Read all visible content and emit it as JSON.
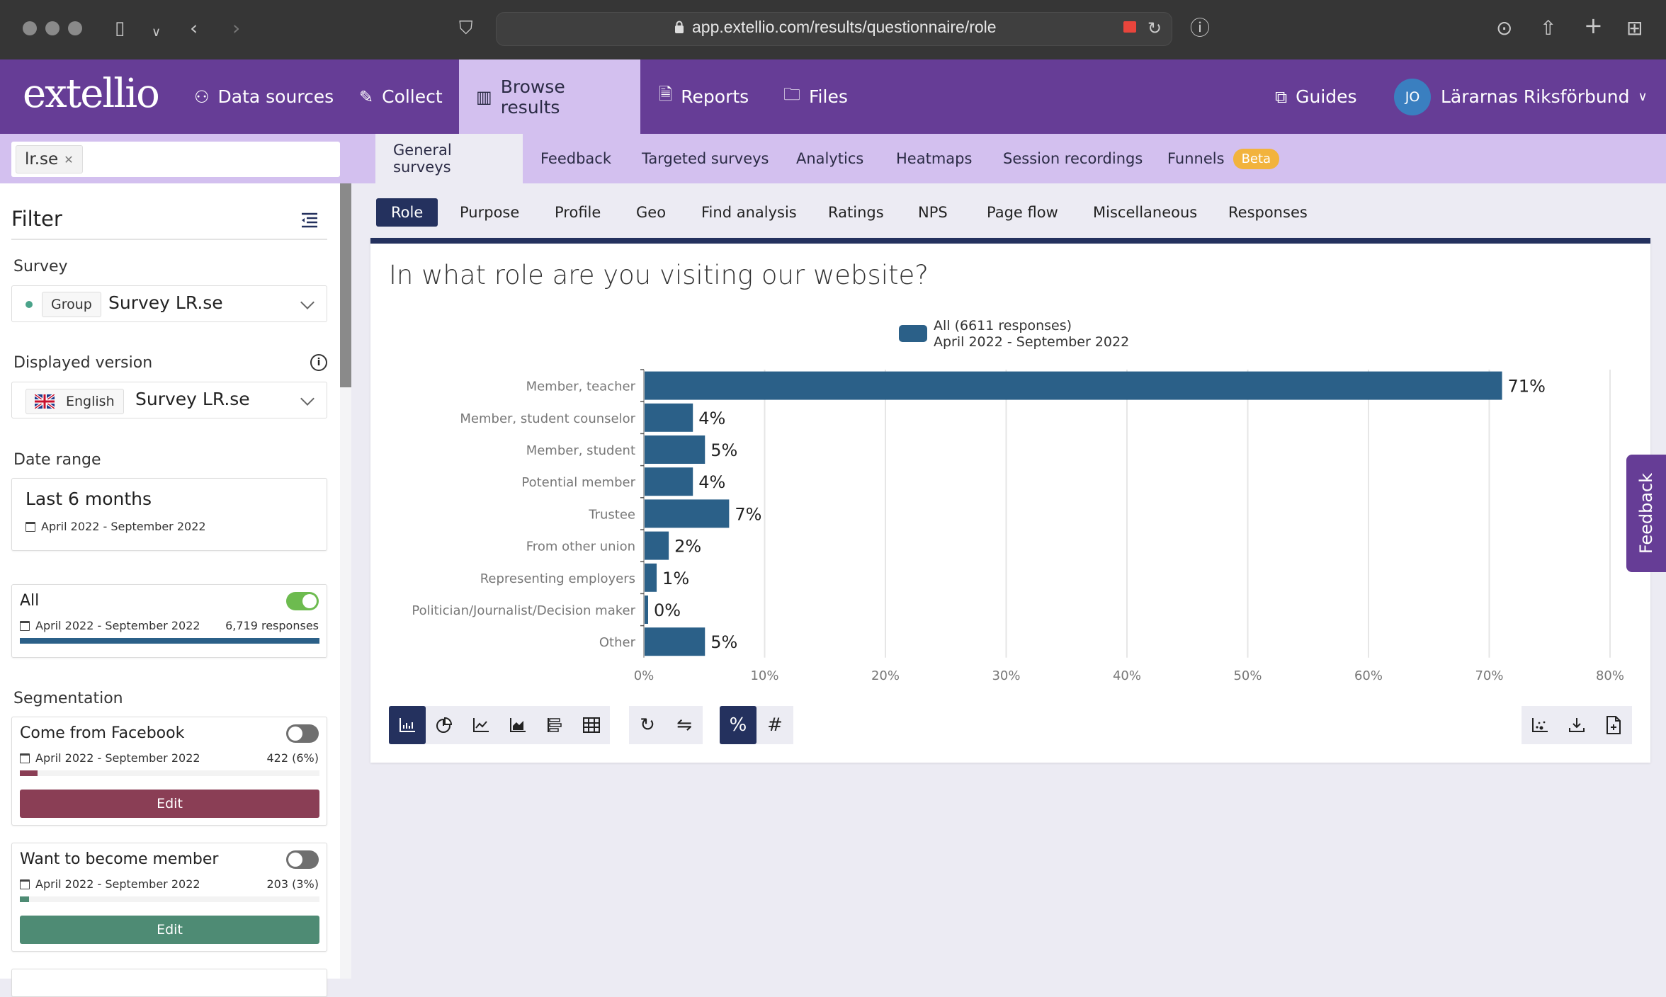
{
  "browser": {
    "url": "app.extellio.com/results/questionnaire/role"
  },
  "nav": {
    "logo": "extellio",
    "items": [
      {
        "label": "Data sources",
        "icon": "sitemap-icon"
      },
      {
        "label": "Collect",
        "icon": "edit-icon"
      },
      {
        "label": "Browse results",
        "icon": "bar-chart-icon",
        "active": true
      },
      {
        "label": "Reports",
        "icon": "document-icon"
      },
      {
        "label": "Files",
        "icon": "folder-icon"
      }
    ],
    "guides": "Guides",
    "avatar_initials": "JO",
    "org_name": "Lärarnas Riksförbund"
  },
  "subnav": {
    "domain_tag": "lr.se",
    "tabs": [
      {
        "label": "General surveys",
        "active": true
      },
      {
        "label": "Feedback"
      },
      {
        "label": "Targeted surveys"
      },
      {
        "label": "Analytics"
      },
      {
        "label": "Heatmaps"
      },
      {
        "label": "Session recordings"
      },
      {
        "label": "Funnels",
        "badge": "Beta"
      }
    ]
  },
  "sidebar": {
    "title": "Filter",
    "survey": {
      "label": "Survey",
      "chip": "Group",
      "value": "Survey LR.se"
    },
    "version": {
      "label": "Displayed version",
      "chip": "English",
      "value": "Survey LR.se"
    },
    "date_range": {
      "label": "Date range",
      "value": "Last 6 months",
      "range": "April 2022 - September 2022"
    },
    "all": {
      "title": "All",
      "range": "April 2022 - September 2022",
      "count": "6,719 responses",
      "enabled": true,
      "fill_fraction": 1.0,
      "color": "#2b6088"
    },
    "segmentation_label": "Segmentation",
    "segments": [
      {
        "title": "Come from Facebook",
        "range": "April 2022 - September 2022",
        "count": "422 (6%)",
        "fill_fraction": 0.06,
        "color": "#8a3e55",
        "enabled": false,
        "edit": "Edit"
      },
      {
        "title": "Want to become member",
        "range": "April 2022 - September 2022",
        "count": "203 (3%)",
        "fill_fraction": 0.03,
        "color": "#4e8b74",
        "enabled": false,
        "edit": "Edit"
      }
    ]
  },
  "chart_tabs": [
    {
      "label": "Role",
      "active": true
    },
    {
      "label": "Purpose"
    },
    {
      "label": "Profile"
    },
    {
      "label": "Geo"
    },
    {
      "label": "Find analysis"
    },
    {
      "label": "Ratings"
    },
    {
      "label": "NPS"
    },
    {
      "label": "Page flow"
    },
    {
      "label": "Miscellaneous"
    },
    {
      "label": "Responses"
    }
  ],
  "chart_data": {
    "type": "bar",
    "orientation": "horizontal",
    "title": "In what role are you visiting our website?",
    "categories": [
      "Member, teacher",
      "Member, student counselor",
      "Member, student",
      "Potential member",
      "Trustee",
      "From other union",
      "Representing employers",
      "Politician/Journalist/Decision maker",
      "Other"
    ],
    "series": [
      {
        "name": "All (6611 responses)",
        "subtitle": "April 2022 - September 2022",
        "color": "#2b6088",
        "values": [
          71,
          4,
          5,
          4,
          7,
          2,
          1,
          0,
          5
        ],
        "labels": [
          "71%",
          "4%",
          "5%",
          "4%",
          "7%",
          "2%",
          "1%",
          "0%",
          "5%"
        ]
      }
    ],
    "xlim": [
      0,
      80
    ],
    "xticks": [
      "0%",
      "10%",
      "20%",
      "30%",
      "40%",
      "50%",
      "60%",
      "70%",
      "80%"
    ],
    "grid": true,
    "legend": "top-center"
  },
  "toolbar": {
    "chart_types": [
      "bar-chart-icon",
      "pie-chart-icon",
      "line-chart-icon",
      "area-chart-icon",
      "stacked-bar-icon",
      "table-icon"
    ],
    "actions": [
      "rotate-icon",
      "swap-icon"
    ],
    "modes": [
      {
        "label": "%",
        "active": true
      },
      {
        "label": "#"
      }
    ],
    "right": [
      "scatter-icon",
      "download-icon",
      "add-to-report-icon"
    ]
  },
  "feedback_tab": "Feedback"
}
